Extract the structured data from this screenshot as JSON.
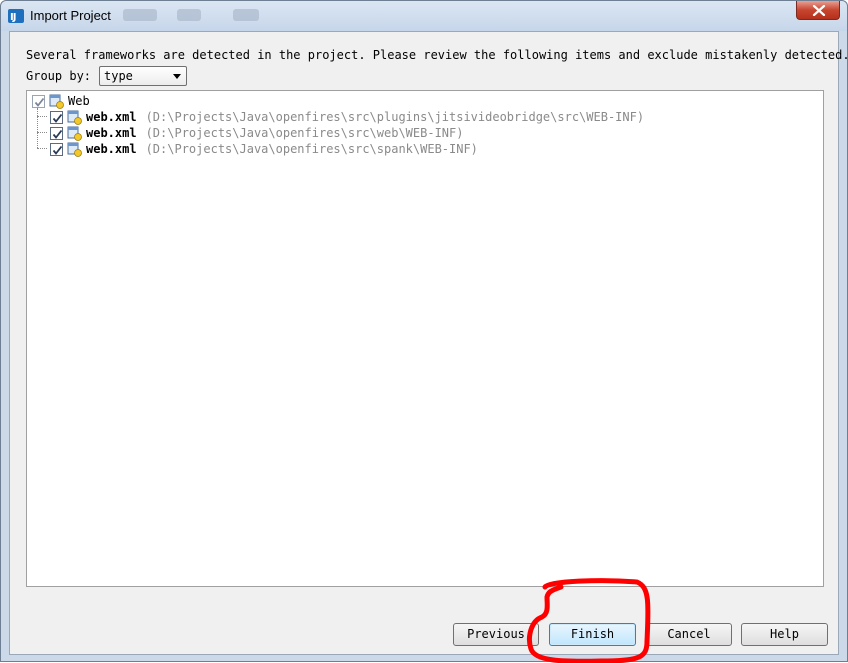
{
  "window": {
    "title": "Import Project"
  },
  "main": {
    "message": "Several frameworks are detected in the project. Please review the following items and exclude mistakenly detected.",
    "group_by_label": "Group by:",
    "group_by_value": "type"
  },
  "tree": {
    "root": {
      "label": "Web",
      "checked": true
    },
    "items": [
      {
        "name": "web.xml",
        "path": "(D:\\Projects\\Java\\openfires\\src\\plugins\\jitsivideobridge\\src\\WEB-INF)",
        "checked": true
      },
      {
        "name": "web.xml",
        "path": "(D:\\Projects\\Java\\openfires\\src\\web\\WEB-INF)",
        "checked": true
      },
      {
        "name": "web.xml",
        "path": "(D:\\Projects\\Java\\openfires\\src\\spank\\WEB-INF)",
        "checked": true
      }
    ]
  },
  "buttons": {
    "previous": "Previous",
    "finish": "Finish",
    "cancel": "Cancel",
    "help": "Help"
  },
  "colors": {
    "annotation": "#ff0000",
    "checkmark": "#2a3a55",
    "default_button_border": "#3c7fb1"
  }
}
